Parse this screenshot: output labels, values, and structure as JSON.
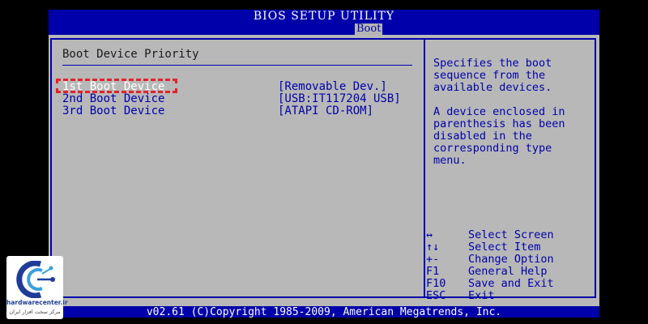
{
  "window": {
    "title": "BIOS SETUP UTILITY",
    "active_tab": "Boot"
  },
  "section": {
    "title": "Boot Device Priority"
  },
  "boot_devices": [
    {
      "label": "1st Boot Device",
      "value": "[Removable Dev.]",
      "selected": true
    },
    {
      "label": "2nd Boot Device",
      "value": "[USB:IT117204 USB]",
      "selected": false
    },
    {
      "label": "3rd Boot Device",
      "value": "[ATAPI CD-ROM]",
      "selected": false
    }
  ],
  "help": {
    "line1": "Specifies the boot",
    "line2": "sequence from the",
    "line3": "available devices.",
    "line4": "A device enclosed in",
    "line5": "parenthesis has been",
    "line6": "disabled in the",
    "line7": "corresponding type",
    "line8": "menu."
  },
  "keys": [
    {
      "key": "↔",
      "desc": "Select Screen"
    },
    {
      "key": "↑↓",
      "desc": "Select Item"
    },
    {
      "key": "+-",
      "desc": "Change Option"
    },
    {
      "key": "F1",
      "desc": "General Help"
    },
    {
      "key": "F10",
      "desc": "Save and Exit"
    },
    {
      "key": "ESC",
      "desc": "Exit"
    }
  ],
  "footer": "v02.61 (C)Copyright 1985-2009, American Megatrends, Inc.",
  "watermark": {
    "name": "hardwarecenter.ir",
    "subtitle": "مرکز سخت افزار ایران"
  },
  "colors": {
    "bios_blue": "#0000aa",
    "panel_gray": "#b8b8b8",
    "highlight_red": "#e0242b"
  }
}
